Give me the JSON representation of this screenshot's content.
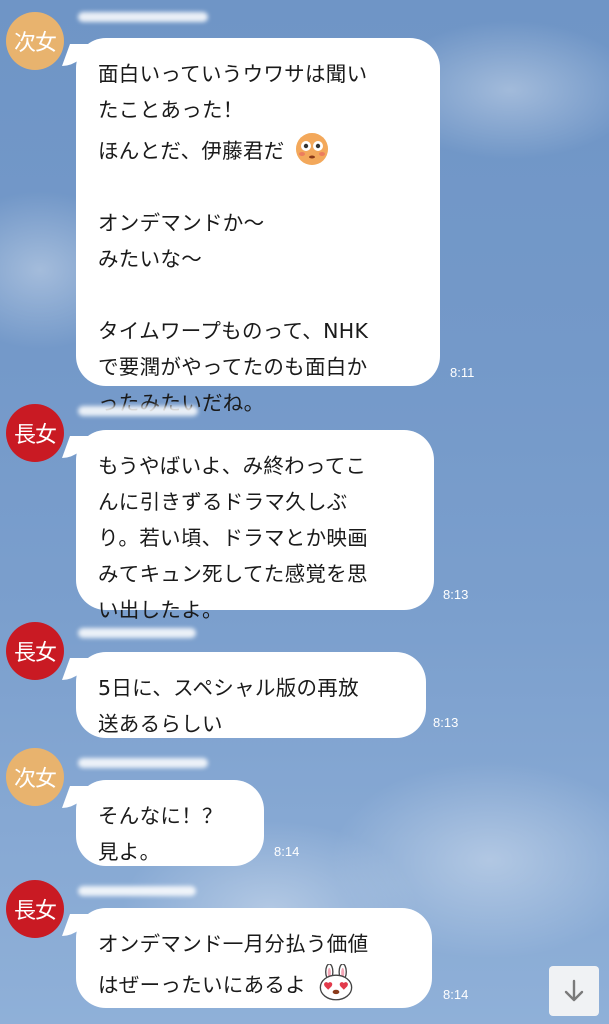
{
  "messages": [
    {
      "sender": "次女",
      "lines": [
        "面白いっていうウワサは聞い",
        "たことあった！",
        "ほんとだ、伊藤君だ",
        "",
        "オンデマンドか〜",
        "みたいな〜",
        "",
        "タイムワープものって、NHK",
        "で要潤がやってたのも面白か",
        "ったみたいだね。"
      ],
      "emoji_after_line": 2,
      "emoji": "flushed-face",
      "time": "8:11"
    },
    {
      "sender": "長女",
      "lines": [
        "もうやばいよ、み終わってこ",
        "んに引きずるドラマ久しぶ",
        "り。若い頃、ドラマとか映画",
        "みてキュン死してた感覚を思",
        "い出したよ。"
      ],
      "time": "8:13"
    },
    {
      "sender": "長女",
      "lines": [
        "5日に、スペシャル版の再放",
        "送あるらしい"
      ],
      "time": "8:13"
    },
    {
      "sender": "次女",
      "lines": [
        "そんなに！？",
        "見よ。"
      ],
      "time": "8:14"
    },
    {
      "sender": "長女",
      "lines": [
        "オンデマンド一月分払う価値",
        "はぜーったいにあるよ"
      ],
      "emoji_after_line": 1,
      "emoji": "heart-eyes-rabbit",
      "time": "8:14"
    }
  ],
  "colors": {
    "jijo_avatar": "#e8b36e",
    "chojo_avatar": "#c91a23",
    "bubble": "#ffffff",
    "background": "#7499c9"
  },
  "scroll_button": {
    "icon": "arrow-down-icon"
  }
}
